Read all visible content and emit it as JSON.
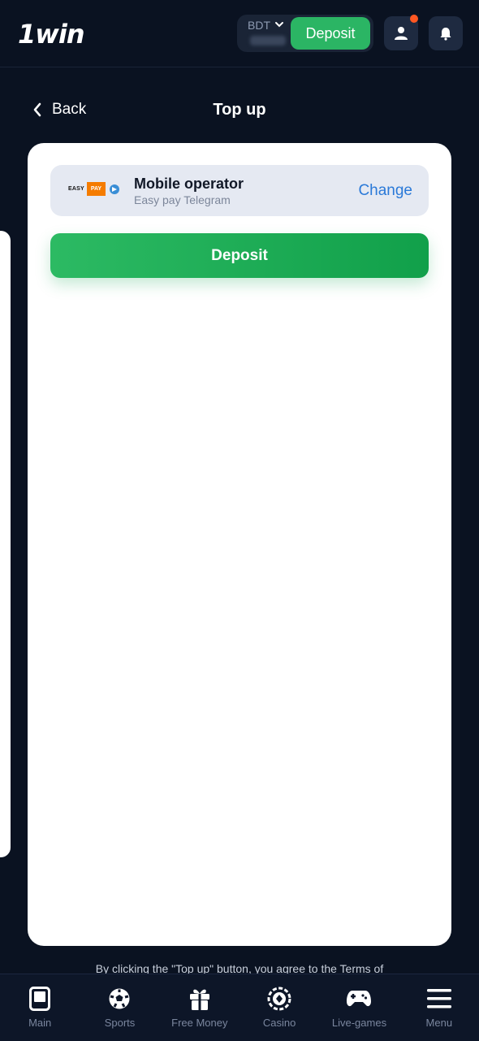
{
  "header": {
    "logo": "1win",
    "currency": "BDT",
    "deposit_label": "Deposit",
    "icons": [
      "chevron-down-icon",
      "user-icon",
      "bell-icon"
    ],
    "colors": {
      "deposit": "#2bb564",
      "notification_dot": "#ff5722"
    }
  },
  "titlebar": {
    "back_label": "Back",
    "title": "Top up"
  },
  "payment": {
    "logo_easy": "EASY",
    "logo_pay": "PAY",
    "method_title": "Mobile operator",
    "method_subtitle": "Easy pay Telegram",
    "change_label": "Change",
    "deposit_label": "Deposit"
  },
  "terms_text": "By clicking the \"Top up\" button, you agree to the Terms of",
  "bottom_nav": [
    {
      "label": "Main",
      "icon": "main-icon"
    },
    {
      "label": "Sports",
      "icon": "soccer-ball-icon"
    },
    {
      "label": "Free Money",
      "icon": "gift-icon"
    },
    {
      "label": "Casino",
      "icon": "casino-chip-icon"
    },
    {
      "label": "Live-games",
      "icon": "gamepad-icon"
    },
    {
      "label": "Menu",
      "icon": "menu-icon"
    }
  ]
}
